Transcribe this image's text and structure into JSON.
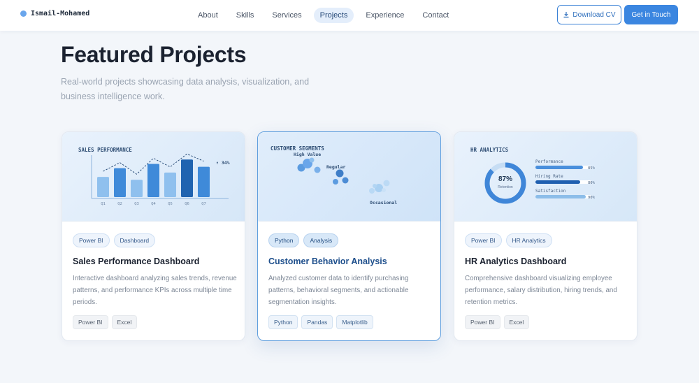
{
  "nav": {
    "logo_text": "Ismail-Mohamed",
    "links": [
      "About",
      "Skills",
      "Services",
      "Projects",
      "Experience",
      "Contact"
    ],
    "active": "Projects",
    "download_cv": "Download CV",
    "get_in_touch": "Get in Touch"
  },
  "header": {
    "title": "Featured Projects",
    "subtitle": "Real-world projects showcasing data analysis, visualization, and business intelligence work."
  },
  "colors": {
    "accent": "#3b86e0",
    "bar_dark": "#1f63b0",
    "bar_mid": "#3f8ad9",
    "bar_light": "#8fc0ee"
  },
  "projects": [
    {
      "tags": [
        "Power BI",
        "Dashboard"
      ],
      "title": "Sales Performance Dashboard",
      "description": "Interactive dashboard analyzing sales trends, revenue patterns, and performance KPIs across multiple time periods.",
      "tools": [
        "Power BI",
        "Excel"
      ],
      "preview": {
        "heading": "SALES PERFORMANCE",
        "badge": "↑ 34%",
        "categories": [
          "Q1",
          "Q2",
          "Q3",
          "Q4",
          "Q5",
          "Q6",
          "Q7"
        ],
        "values": [
          28,
          40,
          24,
          46,
          34,
          52,
          42
        ]
      }
    },
    {
      "tags": [
        "Python",
        "Analysis"
      ],
      "title": "Customer Behavior Analysis",
      "description": "Analyzed customer data to identify purchasing patterns, behavioral segments, and actionable segmentation insights.",
      "tools": [
        "Python",
        "Pandas",
        "Matplotlib"
      ],
      "preview": {
        "heading": "CUSTOMER SEGMENTS",
        "labels": [
          "High Value",
          "Regular",
          "Occasional"
        ]
      }
    },
    {
      "tags": [
        "Power BI",
        "HR Analytics"
      ],
      "title": "HR Analytics Dashboard",
      "description": "Comprehensive dashboard visualizing employee performance, salary distribution, hiring trends, and retention metrics.",
      "tools": [
        "Power BI",
        "Excel"
      ],
      "preview": {
        "heading": "HR ANALYTICS",
        "donut_value": "87%",
        "donut_label": "Retention",
        "donut_fraction": 0.87,
        "metrics": [
          {
            "label": "Performance",
            "value": "85%",
            "fraction": 0.85
          },
          {
            "label": "Hiring Rate",
            "value": "80%",
            "fraction": 0.8
          },
          {
            "label": "Satisfaction",
            "value": "90%",
            "fraction": 0.9
          }
        ]
      }
    }
  ]
}
